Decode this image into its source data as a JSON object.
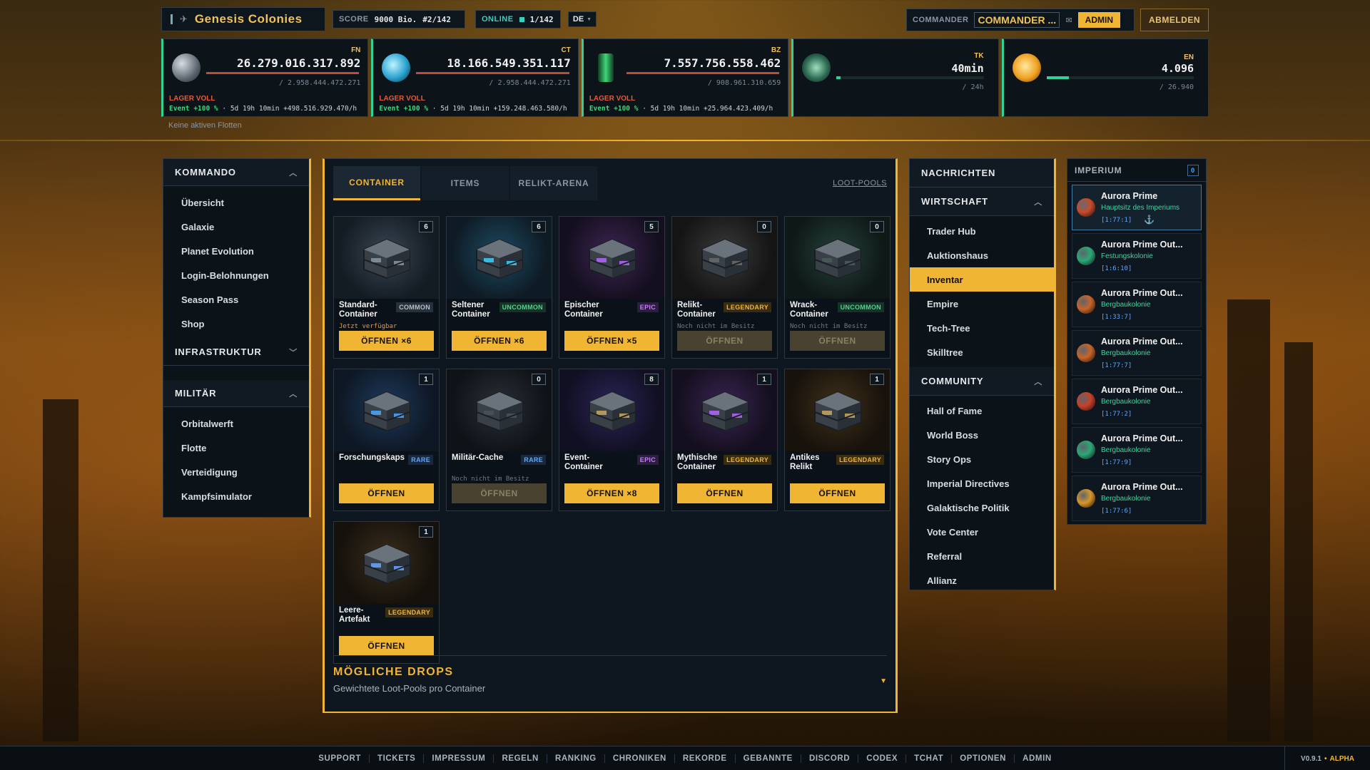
{
  "brand": {
    "name": "Genesis Colonies"
  },
  "score": {
    "label": "SCORE",
    "value": "9000 Bio.",
    "rank": "#2/142"
  },
  "online": {
    "label": "ONLINE",
    "value": "1/142"
  },
  "language": {
    "value": "DE"
  },
  "commander": {
    "label": "COMMANDER",
    "name": "COMMANDER ...",
    "role": "ADMIN"
  },
  "logout_label": "ABMELDEN",
  "resources": [
    {
      "code": "FN",
      "amount": "26.279.016.317.892",
      "capacity": "/ 2.958.444.472.271",
      "status": "LAGER VOLL",
      "event": "Event +100 %",
      "timer": "· 5d 19h 10min",
      "rate": "+498.516.929.470/h",
      "color": "#8a96a3"
    },
    {
      "code": "CT",
      "amount": "18.166.549.351.117",
      "capacity": "/ 2.958.444.472.271",
      "status": "LAGER VOLL",
      "event": "Event +100 %",
      "timer": "· 5d 19h 10min",
      "rate": "+159.248.463.580/h",
      "color": "#3ab8e0"
    },
    {
      "code": "BZ",
      "amount": "7.557.756.558.462",
      "capacity": "/ 908.961.310.659",
      "status": "LAGER VOLL",
      "event": "Event +100 %",
      "timer": "· 5d 19h 10min",
      "rate": "+25.964.423.409/h",
      "color": "#3ed67a"
    }
  ],
  "tk": {
    "code": "TK",
    "value": "40min",
    "sub": "/ 24h"
  },
  "en": {
    "code": "EN",
    "value": "4.096",
    "sub": "/ 26.940"
  },
  "fleets_text": "Keine aktiven Flotten",
  "left_nav": {
    "kommando": {
      "title": "KOMMANDO",
      "items": [
        "Übersicht",
        "Galaxie",
        "Planet Evolution",
        "Login-Belohnungen",
        "Season Pass",
        "Shop"
      ]
    },
    "infrastruktur": {
      "title": "INFRASTRUKTUR"
    },
    "militaer": {
      "title": "MILITÄR",
      "items": [
        "Orbitalwerft",
        "Flotte",
        "Verteidigung",
        "Kampfsimulator"
      ]
    }
  },
  "tabs": [
    "CONTAINER",
    "ITEMS",
    "RELIKT-ARENA"
  ],
  "loot_pools_link": "LOOT-POOLS",
  "containers": [
    {
      "name": "Standard-Container",
      "count": "6",
      "rarity": "COMMON",
      "note": "Jetzt verfügbar",
      "button": "ÖFFNEN ×6",
      "enabled": true
    },
    {
      "name": "Seltener Container",
      "count": "6",
      "rarity": "UNCOMMON",
      "note": "",
      "button": "ÖFFNEN ×6",
      "enabled": true
    },
    {
      "name": "Epischer Container",
      "count": "5",
      "rarity": "EPIC",
      "note": "",
      "button": "ÖFFNEN ×5",
      "enabled": true
    },
    {
      "name": "Relikt-Container",
      "count": "0",
      "rarity": "LEGENDARY",
      "note": "Noch nicht im Besitz",
      "button": "ÖFFNEN",
      "enabled": false
    },
    {
      "name": "Wrack-Container",
      "count": "0",
      "rarity": "UNCOMMON",
      "note": "Noch nicht im Besitz",
      "button": "ÖFFNEN",
      "enabled": false
    },
    {
      "name": "Forschungskaps",
      "count": "1",
      "rarity": "RARE",
      "note": "",
      "button": "ÖFFNEN",
      "enabled": true
    },
    {
      "name": "Militär-Cache",
      "count": "0",
      "rarity": "RARE",
      "note": "Noch nicht im Besitz",
      "button": "ÖFFNEN",
      "enabled": false
    },
    {
      "name": "Event-Container",
      "count": "8",
      "rarity": "EPIC",
      "note": "",
      "button": "ÖFFNEN ×8",
      "enabled": true
    },
    {
      "name": "Mythische Container",
      "count": "1",
      "rarity": "LEGENDARY",
      "note": "",
      "button": "ÖFFNEN",
      "enabled": true
    },
    {
      "name": "Antikes Relikt",
      "count": "1",
      "rarity": "LEGENDARY",
      "note": "",
      "button": "ÖFFNEN",
      "enabled": true
    },
    {
      "name": "Leere-Artefakt",
      "count": "1",
      "rarity": "LEGENDARY",
      "note": "",
      "button": "ÖFFNEN",
      "enabled": true
    }
  ],
  "drops": {
    "title": "MÖGLICHE DROPS",
    "subtitle": "Gewichtete Loot-Pools pro Container"
  },
  "right_nav": {
    "nachrichten": "NACHRICHTEN",
    "wirtschaft": {
      "title": "WIRTSCHAFT",
      "items": [
        "Trader Hub",
        "Auktionshaus",
        "Inventar",
        "Empire",
        "Tech-Tree",
        "Skilltree"
      ],
      "active": "Inventar"
    },
    "community": {
      "title": "COMMUNITY",
      "items": [
        "Hall of Fame",
        "World Boss",
        "Story Ops",
        "Imperial Directives",
        "Galaktische Politik",
        "Vote Center",
        "Referral",
        "Allianz"
      ]
    }
  },
  "imperium": {
    "title": "IMPERIUM",
    "badge": "0",
    "colonies": [
      {
        "name": "Aurora Prime",
        "type": "Hauptsitz des Imperiums",
        "coord": "[1:77:1]",
        "color": "#c84a2a",
        "active": true
      },
      {
        "name": "Aurora Prime Out...",
        "type": "Festungskolonie",
        "coord": "[1:6:10]",
        "color": "#2aa878"
      },
      {
        "name": "Aurora Prime Out...",
        "type": "Bergbaukolonie",
        "coord": "[1:33:7]",
        "color": "#c8642a"
      },
      {
        "name": "Aurora Prime Out...",
        "type": "Bergbaukolonie",
        "coord": "[1:77:7]",
        "color": "#c8642a"
      },
      {
        "name": "Aurora Prime Out...",
        "type": "Bergbaukolonie",
        "coord": "[1:77:2]",
        "color": "#c8402a"
      },
      {
        "name": "Aurora Prime Out...",
        "type": "Bergbaukolonie",
        "coord": "[1:77:9]",
        "color": "#2aa878"
      },
      {
        "name": "Aurora Prime Out...",
        "type": "Bergbaukolonie",
        "coord": "[1:77:6]",
        "color": "#d8962a"
      }
    ]
  },
  "footer": {
    "links": [
      "SUPPORT",
      "TICKETS",
      "IMPRESSUM",
      "REGELN",
      "RANKING",
      "CHRONIKEN",
      "REKORDE",
      "GEBANNTE",
      "DISCORD",
      "CODEX",
      "TCHAT",
      "OPTIONEN",
      "ADMIN"
    ],
    "version": "V0.9.1",
    "stage": "ALPHA"
  },
  "colors": {
    "accent": "#f0b532",
    "positive": "#3ed67a",
    "warning": "#e25b3c"
  }
}
